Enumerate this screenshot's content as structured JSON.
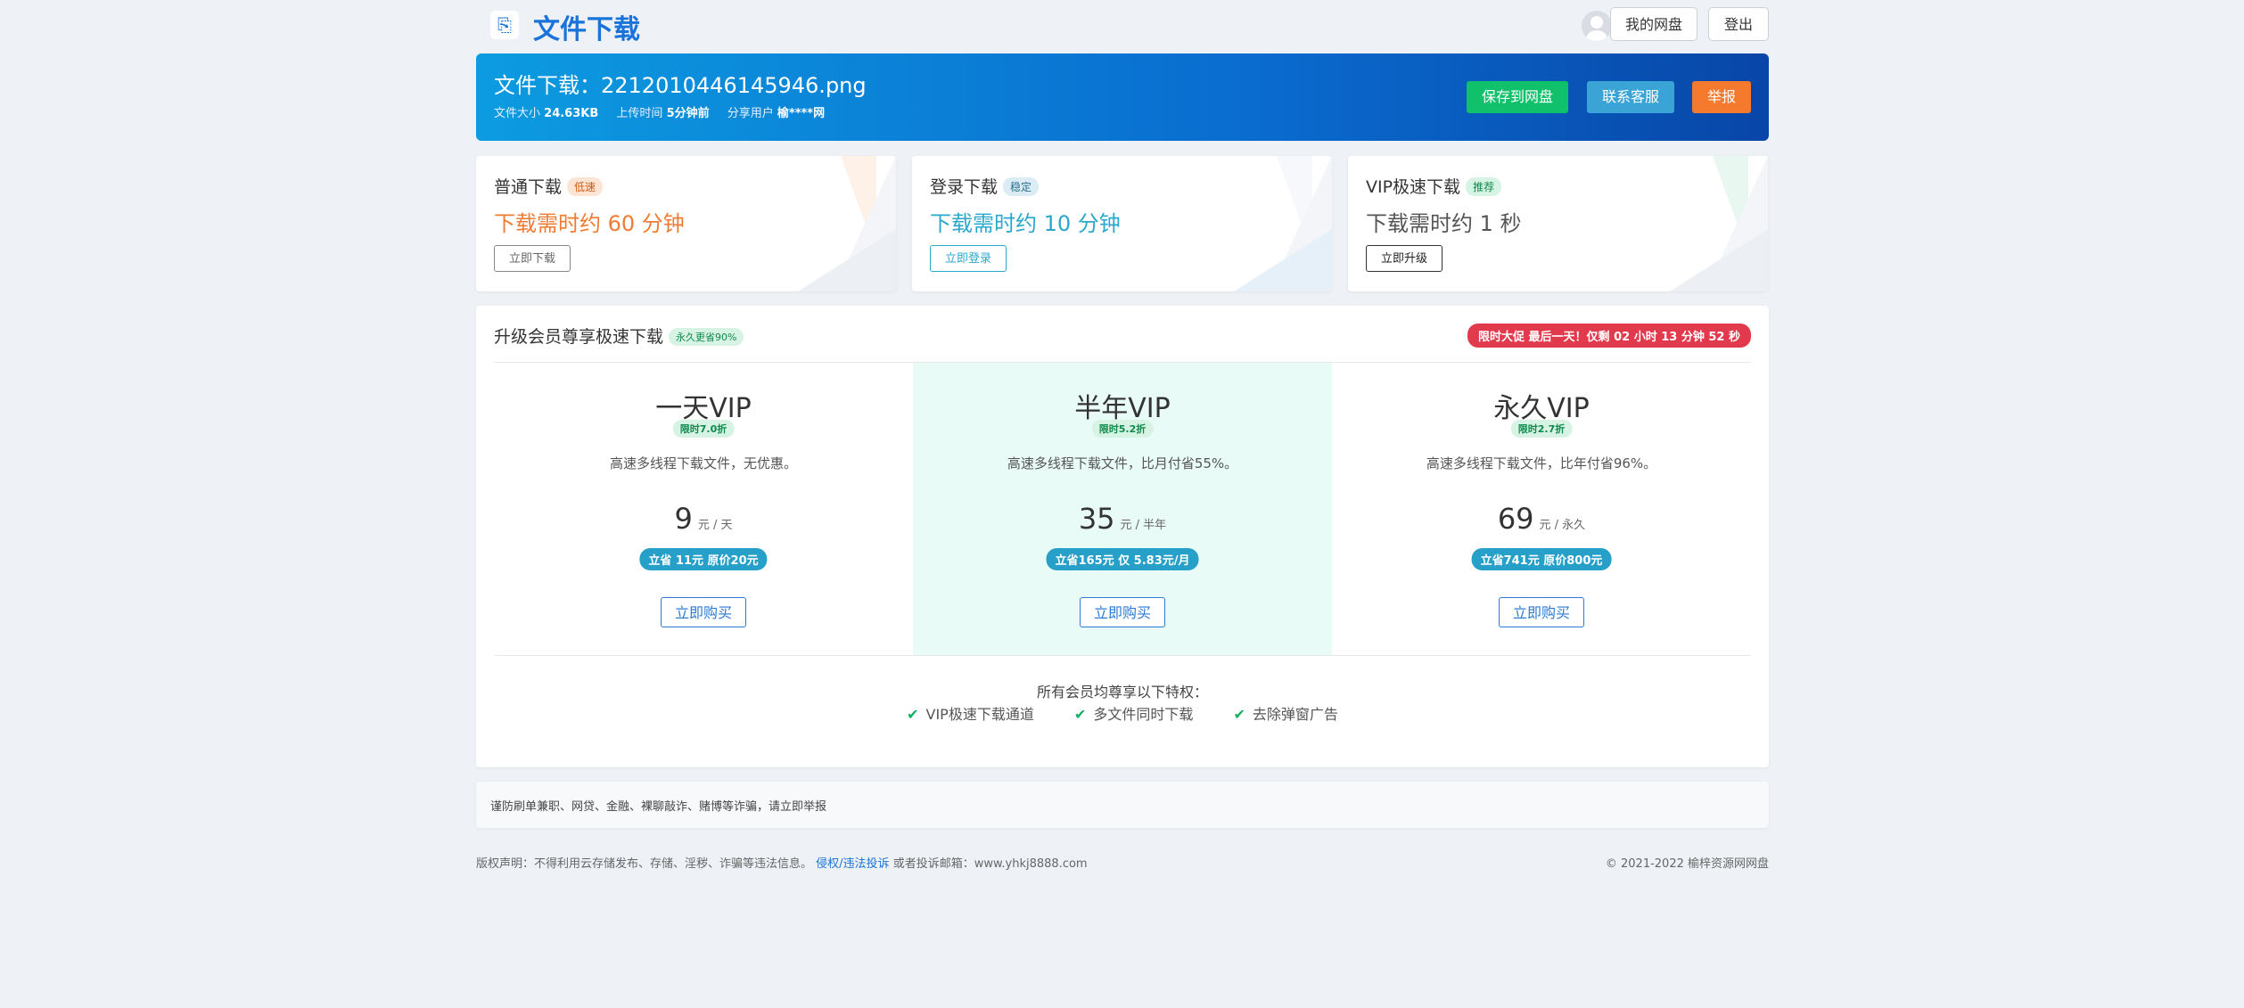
{
  "header": {
    "site_title": "文件下载",
    "my_cloud_label": "我的网盘",
    "logout_label": "登出"
  },
  "banner": {
    "file_title": "文件下载：2212010446145946.png",
    "size_label": "文件大小",
    "size_value": "24.63KB",
    "upload_label": "上传时间",
    "upload_value": "5分钟前",
    "user_label": "分享用户",
    "user_value": "榆****网",
    "save_label": "保存到网盘",
    "service_label": "联系客服",
    "report_label": "举报"
  },
  "options": [
    {
      "title": "普通下载",
      "tag": "低速",
      "time": "下载需时约 60 分钟",
      "button": "立即下载"
    },
    {
      "title": "登录下载",
      "tag": "稳定",
      "time": "下载需时约 10 分钟",
      "button": "立即登录"
    },
    {
      "title": "VIP极速下载",
      "tag": "推荐",
      "time": "下载需时约 1 秒",
      "button": "立即升级"
    }
  ],
  "vip": {
    "title": "升级会员尊享极速下载",
    "title_tag": "永久更省90%",
    "promo": "限时大促 最后一天！仅剩 02 小时 13 分钟 52 秒",
    "plans": [
      {
        "name": "一天VIP",
        "badge": "限时7.0折",
        "desc": "高速多线程下载文件，无优惠。",
        "price": "9",
        "unit": "元 / 天",
        "save": "立省 11元 原价20元",
        "button": "立即购买"
      },
      {
        "name": "半年VIP",
        "badge": "限时5.2折",
        "desc": "高速多线程下载文件，比月付省55%。",
        "price": "35",
        "unit": "元 / 半年",
        "save": "立省165元 仅 5.83元/月",
        "button": "立即购买"
      },
      {
        "name": "永久VIP",
        "badge": "限时2.7折",
        "desc": "高速多线程下载文件，比年付省96%。",
        "price": "69",
        "unit": "元 / 永久",
        "save": "立省741元 原价800元",
        "button": "立即购买"
      }
    ],
    "perks_title": "所有会员均尊享以下特权：",
    "perks": [
      "VIP极速下载通道",
      "多文件同时下载",
      "去除弹窗广告"
    ]
  },
  "notice": "谨防刷单兼职、网贷、金融、裸聊敲诈、赌博等诈骗，请立即举报",
  "footer": {
    "left_text": "版权声明：不得利用云存储发布、存储、淫秽、诈骗等违法信息。",
    "left_link": "侵权/违法投诉",
    "left_tail": "或者投诉邮箱：www.yhkj8888.com",
    "right_text": "© 2021-2022 榆梓资源网网盘"
  },
  "colors": {
    "brand": "#1a73d8",
    "save_button": "#10c06b",
    "service_button": "#3aa4d6",
    "report_button": "#f57a2d",
    "promo": "#e23a4d"
  }
}
